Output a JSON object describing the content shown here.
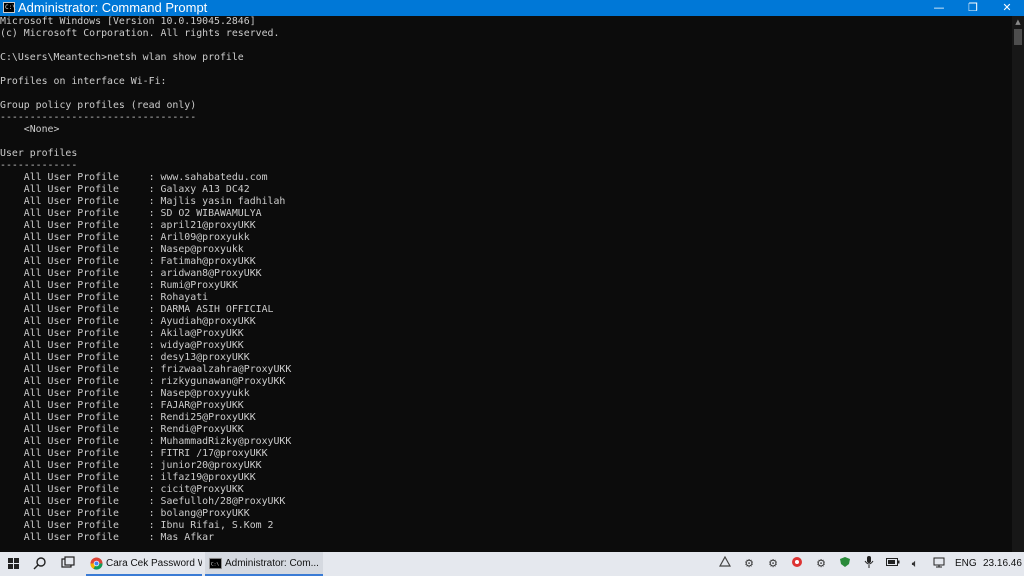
{
  "window": {
    "title": "Administrator: Command Prompt",
    "controls": {
      "minimize": "—",
      "maximize": "❐",
      "close": "✕"
    }
  },
  "console": {
    "lines": [
      "Microsoft Windows [Version 10.0.19045.2846]",
      "(c) Microsoft Corporation. All rights reserved.",
      "",
      "C:\\Users\\Meantech>netsh wlan show profile",
      "",
      "Profiles on interface Wi-Fi:",
      "",
      "Group policy profiles (read only)",
      "---------------------------------",
      "    <None>",
      "",
      "User profiles",
      "-------------",
      "    All User Profile     : www.sahabatedu.com",
      "    All User Profile     : Galaxy A13 DC42",
      "    All User Profile     : Majlis yasin fadhilah",
      "    All User Profile     : SD O2 WIBAWAMULYA",
      "    All User Profile     : april21@proxyUKK",
      "    All User Profile     : Aril09@proxyukk",
      "    All User Profile     : Nasep@proxyukk",
      "    All User Profile     : Fatimah@proxyUKK",
      "    All User Profile     : aridwan8@ProxyUKK",
      "    All User Profile     : Rumi@ProxyUKK",
      "    All User Profile     : Rohayati",
      "    All User Profile     : DARMA ASIH OFFICIAL",
      "    All User Profile     : Ayudiah@proxyUKK",
      "    All User Profile     : Akila@ProxyUKK",
      "    All User Profile     : widya@ProxyUKK",
      "    All User Profile     : desy13@proxyUKK",
      "    All User Profile     : frizwaalzahra@ProxyUKK",
      "    All User Profile     : rizkygunawan@ProxyUKK",
      "    All User Profile     : Nasep@proxyyukk",
      "    All User Profile     : FAJAR@ProxyUKK",
      "    All User Profile     : Rendi25@ProxyUKK",
      "    All User Profile     : Rendi@ProxyUKK",
      "    All User Profile     : MuhammadRizky@proxyUKK",
      "    All User Profile     : FITRI /17@proxyUKK",
      "    All User Profile     : junior20@proxyUKK",
      "    All User Profile     : ilfaz19@proxyUKK",
      "    All User Profile     : cicit@ProxyUKK",
      "    All User Profile     : Saefulloh/28@ProxyUKK",
      "    All User Profile     : bolang@ProxyUKK",
      "    All User Profile     : Ibnu Rifai, S.Kom 2",
      "    All User Profile     : Mas Afkar"
    ]
  },
  "taskbar": {
    "search_icon": "search-icon",
    "taskview_icon": "task-view-icon",
    "tasks": [
      {
        "label": "Cara Cek Password W...",
        "icon": "chrome-icon"
      },
      {
        "label": "Administrator: Com...",
        "icon": "cmd-icon"
      }
    ],
    "language": "ENG",
    "clock": "23.16.46"
  },
  "colors": {
    "titlebar": "#0078d7",
    "console_bg": "#0c0c0c",
    "console_text": "#cccccc",
    "taskbar_bg": "#e5e8ee"
  }
}
